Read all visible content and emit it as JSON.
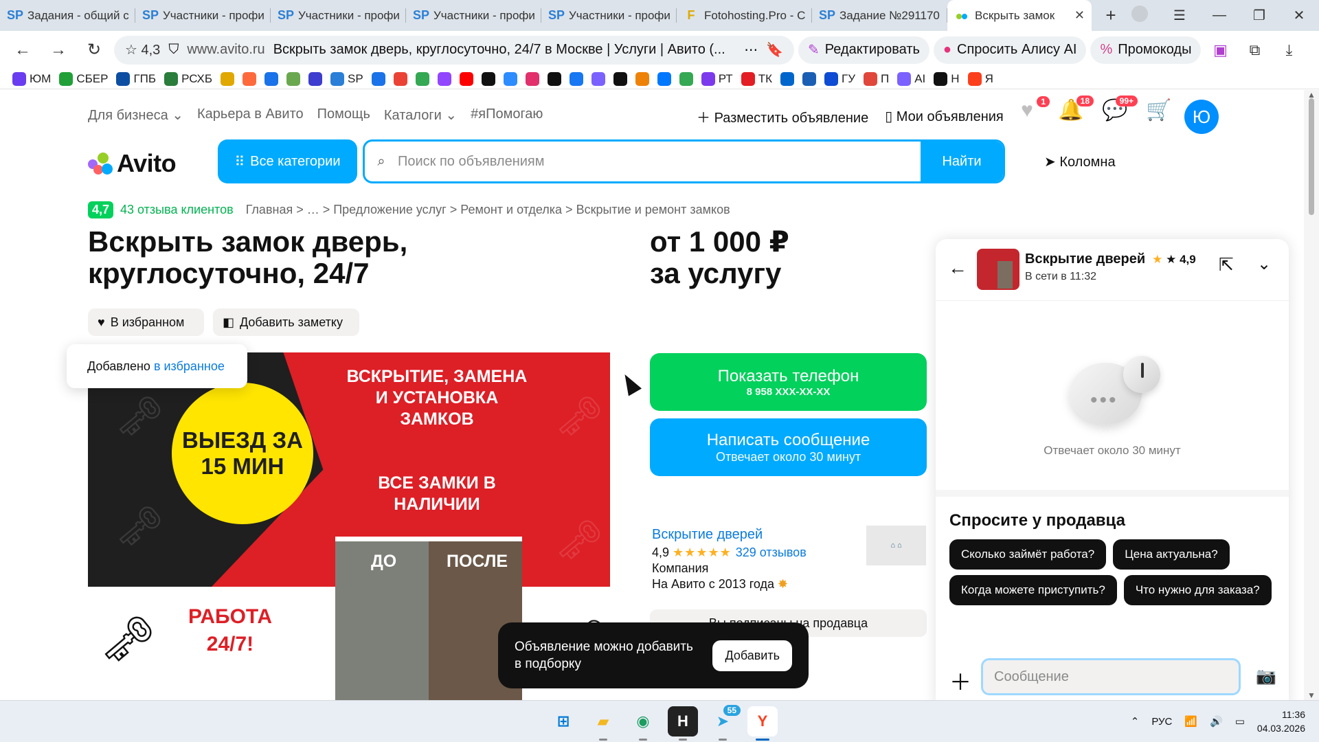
{
  "browser": {
    "tabs": [
      {
        "favicon": "SP",
        "title": "Задания - общий с",
        "color": "#2b7fd6"
      },
      {
        "favicon": "SP",
        "title": "Участники - профи",
        "color": "#2b7fd6"
      },
      {
        "favicon": "SP",
        "title": "Участники - профи",
        "color": "#2b7fd6"
      },
      {
        "favicon": "SP",
        "title": "Участники - профи",
        "color": "#2b7fd6"
      },
      {
        "favicon": "SP",
        "title": "Участники - профи",
        "color": "#2b7fd6"
      },
      {
        "favicon": "F",
        "title": "Fotohosting.Pro - С",
        "color": "#e0a800"
      },
      {
        "favicon": "SP",
        "title": "Задание №291170",
        "color": "#2b7fd6"
      },
      {
        "favicon": "avito",
        "title": "Вскрыть замок",
        "active": true
      }
    ],
    "new_tab": "+",
    "address": {
      "rating": "4,3",
      "domain": "www.avito.ru",
      "page_title": "Вскрыть замок дверь, круглосуточно, 24/7 в Москве | Услуги | Авито (..."
    },
    "chips": {
      "edit": "Редактировать",
      "alice": "Спросить Алису AI",
      "promo": "Промокоды"
    },
    "bookmarks": [
      {
        "label": "ЮМ",
        "icon": "#6a3df0"
      },
      {
        "label": "СБЕР",
        "icon": "#21a038"
      },
      {
        "label": "ГПБ",
        "icon": "#0d4ea2"
      },
      {
        "label": "РСХБ",
        "icon": "#2a7d3b"
      },
      {
        "label": "",
        "icon": "#e0a800"
      },
      {
        "label": "",
        "icon": "#ff6a3d"
      },
      {
        "label": "",
        "icon": "#1a73e8"
      },
      {
        "label": "",
        "icon": "#6aa84f"
      },
      {
        "label": "",
        "icon": "#3d3dcf"
      },
      {
        "label": "SP",
        "icon": "#2b7fd6"
      },
      {
        "label": "",
        "icon": "#1a73e8"
      },
      {
        "label": "",
        "icon": "#ea4335"
      },
      {
        "label": "",
        "icon": "#34a853"
      },
      {
        "label": "",
        "icon": "#9146ff"
      },
      {
        "label": "",
        "icon": "#ff0000"
      },
      {
        "label": "",
        "icon": "#111111"
      },
      {
        "label": "",
        "icon": "#2d8cff"
      },
      {
        "label": "",
        "icon": "#e1306c"
      },
      {
        "label": "",
        "icon": "#111111"
      },
      {
        "label": "",
        "icon": "#1877f2"
      },
      {
        "label": "",
        "icon": "#7b61ff"
      },
      {
        "label": "",
        "icon": "#111111"
      },
      {
        "label": "",
        "icon": "#ee8208"
      },
      {
        "label": "",
        "icon": "#0077ff"
      },
      {
        "label": "",
        "icon": "#34a853"
      },
      {
        "label": "РТ",
        "icon": "#7c3aed"
      },
      {
        "label": "ТК",
        "icon": "#e31e24"
      },
      {
        "label": "",
        "icon": "#0066cc"
      },
      {
        "label": "",
        "icon": "#1a5fb4"
      },
      {
        "label": "ГУ",
        "icon": "#0d4cd3"
      },
      {
        "label": "П",
        "icon": "#e0463a"
      },
      {
        "label": "AI",
        "icon": "#7b61ff"
      },
      {
        "label": "Н",
        "icon": "#111111"
      },
      {
        "label": "Я",
        "icon": "#fc3f1d"
      }
    ]
  },
  "avito": {
    "topnav": [
      "Для бизнеса",
      "Карьера в Авито",
      "Помощь",
      "Каталоги",
      "#яПомогаю"
    ],
    "post_ad": "Разместить объявление",
    "my_ads": "Мои объявления",
    "badges": {
      "favorites": "1",
      "notifications": "18",
      "messages": "99+"
    },
    "avatar_letter": "Ю",
    "logo": "Avito",
    "all_categories": "Все категории",
    "search_placeholder": "Поиск по объявлениям",
    "search_button": "Найти",
    "city": "Коломна",
    "rating": "4,7",
    "reviews_link": "43 отзыва клиентов",
    "breadcrumbs": "Главная  >  …  >  Предложение услуг  >  Ремонт и отделка  >  Вскрытие и ремонт замков",
    "title": "Вскрыть замок дверь, круглосуточно, 24/7",
    "price_line1": "от 1 000 ₽",
    "price_line2": "за услугу",
    "fav_button": "В избранном",
    "note_button": "Добавить заметку",
    "tooltip_text": "Добавлено",
    "tooltip_link": "в избранное",
    "ad_image": {
      "circle": "ВЫЕЗД ЗА 15 МИН",
      "red_top": "ВСКРЫТИЕ, ЗАМЕНА И УСТАНОВКА ЗАМКОВ",
      "red_bottom": "ВСЕ ЗАМКИ В НАЛИЧИИ",
      "work": "РАБОТА 24/7!",
      "before": "ДО",
      "after": "ПОСЛЕ"
    },
    "phone_button": "Показать телефон",
    "phone_number": "8 958 XXX-XX-XX",
    "msg_button": "Написать сообщение",
    "msg_sub": "Отвечает около 30 минут",
    "seller_name": "Вскрытие дверей",
    "seller_rating": "4,9",
    "seller_stars": "★★★★★",
    "seller_reviews": "329 отзывов",
    "seller_type": "Компания",
    "seller_since": "На Авито с 2013 года",
    "subscribed": "Вы подписаны на продавца",
    "toast_text": "Объявление можно добавить в подборку",
    "toast_button": "Добавить"
  },
  "chat": {
    "name": "Вскрытие дверей",
    "rating": "★ 4,9",
    "status": "В сети в 11:32",
    "reply_time": "Отвечает около 30 минут",
    "ask_title": "Спросите у продавца",
    "questions": [
      "Сколько займёт работа?",
      "Цена актуальна?",
      "Когда можете приступить?",
      "Что нужно для заказа?"
    ],
    "input_placeholder": "Сообщение"
  },
  "taskbar": {
    "lang": "РУС",
    "time": "11:36",
    "date": "04.03.2026",
    "telegram_badge": "55"
  }
}
